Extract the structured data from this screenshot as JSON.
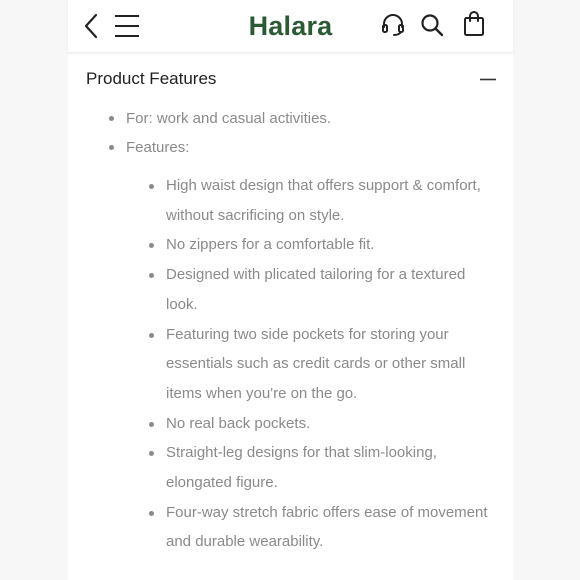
{
  "header": {
    "logo": "Halara",
    "brand_color": "#2c5a34",
    "icons": [
      "chevron-left-icon",
      "hamburger-menu-icon",
      "headset-icon",
      "search-icon",
      "shopping-bag-icon"
    ]
  },
  "section": {
    "title": "Product Features",
    "toggle_icon": "minus-icon"
  },
  "details": {
    "items": [
      "For: work and casual activities.",
      "Features:"
    ],
    "features": [
      "High waist design that offers support & comfort, without sacrificing on style.",
      "No zippers for a comfortable fit.",
      "Designed with plicated tailoring for a textured look.",
      "Featuring two side pockets for storing your essentials such as credit cards or other small items when you're on the go.",
      "No real back pockets.",
      "Straight-leg designs for that slim-looking, elongated figure.",
      "Four-way stretch fabric offers ease of movement and durable wearability."
    ]
  }
}
